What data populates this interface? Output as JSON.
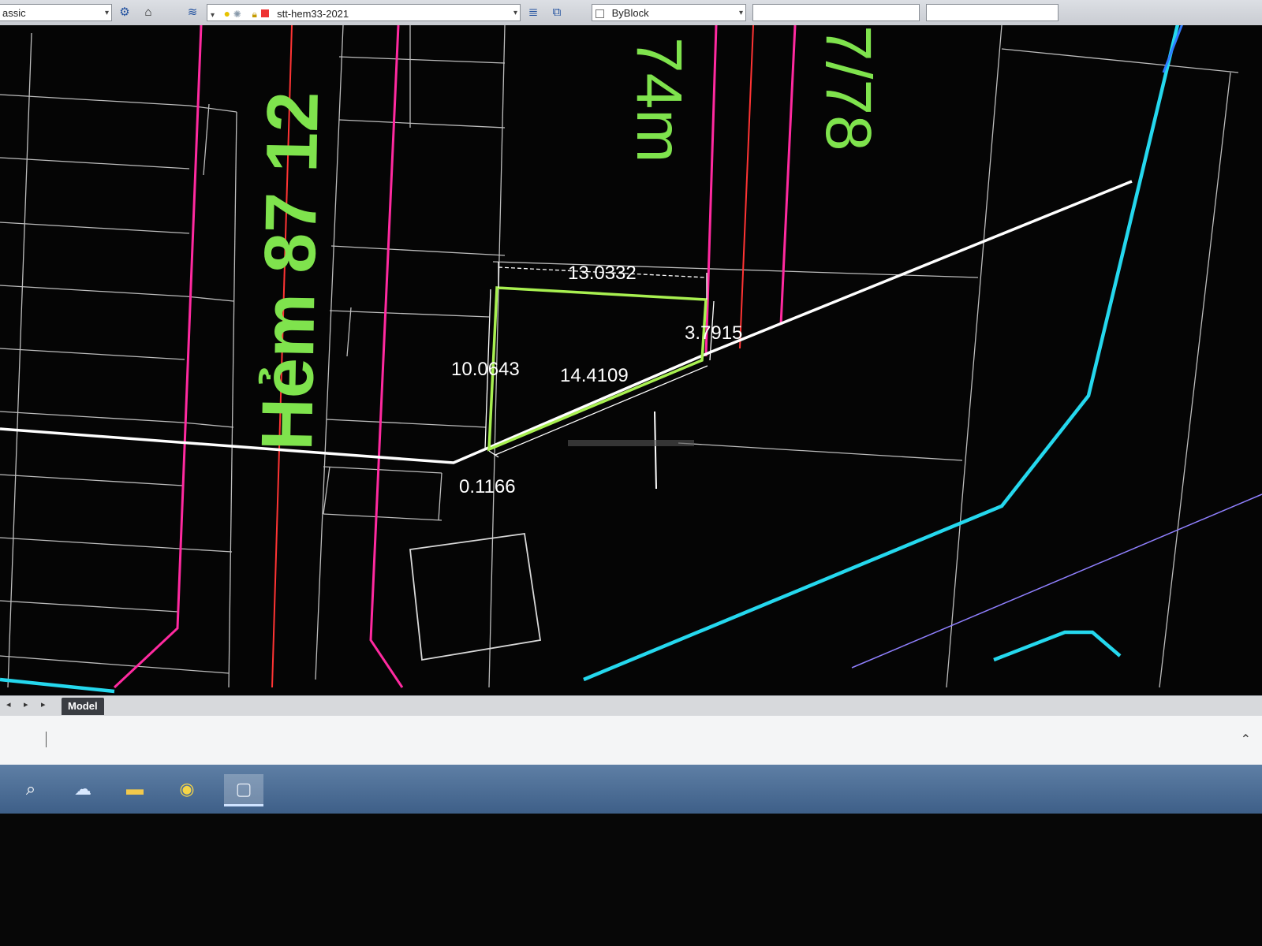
{
  "toolbar": {
    "workspace_select": "assic",
    "layer_select": "stt-hem33-2021",
    "linetype_select": "ByBlock",
    "icons": [
      "settings-icon",
      "save-icon",
      "layers-icon",
      "bulb-icon",
      "sun-icon",
      "lock-icon",
      "color-square-icon",
      "layer-states-icon",
      "match-layer-icon"
    ]
  },
  "drawing": {
    "street_label": "Hẻm 87 12",
    "top_label_1": "74m",
    "top_label_2": "7/78",
    "dimensions": {
      "top": "13.0332",
      "right": "3.7915",
      "left": "10.0643",
      "diagonal": "14.4109",
      "bottom": "0.1166"
    },
    "colors": {
      "lot_outline": "#a8f050",
      "street_text": "#7fe34d",
      "road_border": "#ff2aa0",
      "center_red": "#ff3434",
      "cyan": "#25d8ee",
      "blue": "#2f7cff",
      "violet": "#9080ff",
      "white_line": "#ffffff",
      "grid_line": "#bdbdbd"
    }
  },
  "model_tabs": {
    "active": "Model",
    "nav": [
      "◂",
      "▸",
      "▸"
    ]
  },
  "command_line": {
    "expand_icon": "⌃"
  },
  "taskbar": {
    "icons": [
      "search-icon",
      "cloud-app-icon",
      "folder-icon",
      "chrome-icon",
      "app-window-icon"
    ]
  }
}
